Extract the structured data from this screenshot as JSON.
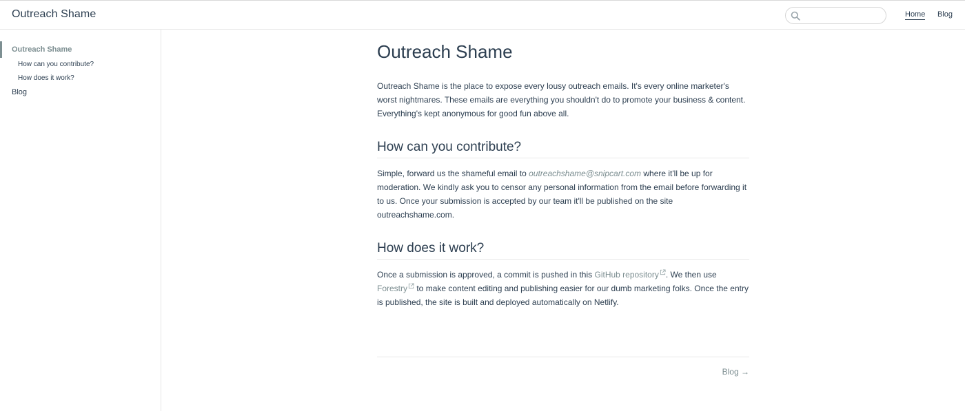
{
  "header": {
    "site_title": "Outreach Shame",
    "search": {
      "placeholder": "",
      "value": ""
    },
    "nav": [
      {
        "label": "Home",
        "active": true
      },
      {
        "label": "Blog",
        "active": false
      }
    ]
  },
  "sidebar": {
    "items": [
      {
        "label": "Outreach Shame",
        "active": true
      },
      {
        "label": "How can you contribute?"
      },
      {
        "label": "How does it work?"
      },
      {
        "label": "Blog"
      }
    ]
  },
  "main": {
    "title": "Outreach Shame",
    "intro": "Outreach Shame is the place to expose every lousy outreach emails. It's every online marketer's worst nightmares. These emails are everything you shouldn't do to promote your business & content. Everything's kept anonymous for good fun above all.",
    "contribute": {
      "heading": "How can you contribute?",
      "text_before": "Simple, forward us the shameful email to ",
      "email": "outreachshame@snipcart.com",
      "text_after": " where it'll be up for moderation. We kindly ask you to censor any personal information from the email before forwarding it to us. Once your submission is accepted by our team it'll be published on the site outreachshame.com."
    },
    "work": {
      "heading": "How does it work?",
      "text_1": "Once a submission is approved, a commit is pushed in this ",
      "link_github": "GitHub repository",
      "text_2": ". We then use ",
      "link_forestry": "Forestry",
      "text_3": " to make content editing and publishing easier for our dumb marketing folks. Once the entry is published, the site is built and deployed automatically on Netlify."
    },
    "next_link": "Blog →"
  },
  "colors": {
    "text": "#2c3e50",
    "accent": "#7b8d90",
    "border": "#e6e6e6"
  },
  "icons": [
    "search-icon",
    "external-link-icon"
  ]
}
